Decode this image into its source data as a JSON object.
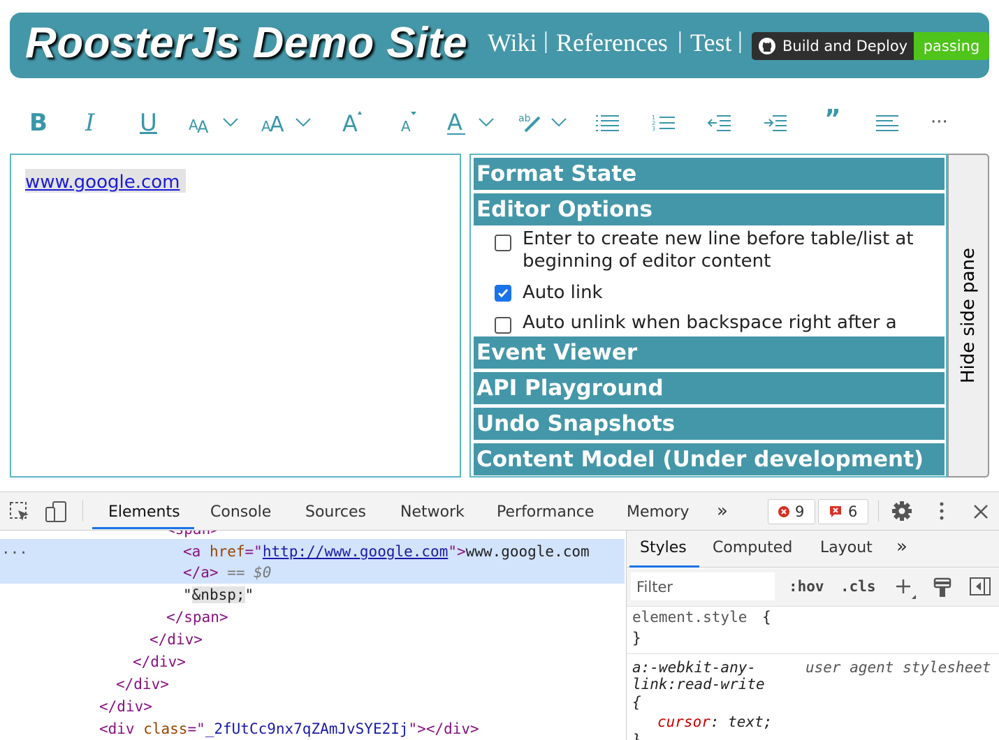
{
  "header": {
    "title": "RoosterJs Demo Site",
    "links": [
      "Wiki",
      "References",
      "Test"
    ],
    "separator": "|",
    "badge_label": "Build and Deploy",
    "badge_status": "passing"
  },
  "toolbar": {
    "bold": "B",
    "italic": "I",
    "underline": "U",
    "more": "···",
    "quote": "”"
  },
  "editor": {
    "link_text": "www.google.com"
  },
  "sidepane": {
    "sections": [
      "Format State",
      "Editor Options",
      "Event Viewer",
      "API Playground",
      "Undo Snapshots",
      "Content Model (Under development)"
    ],
    "options": [
      {
        "label": "Enter to create new line before table/list at beginning of editor content",
        "checked": false
      },
      {
        "label": "Auto link",
        "checked": true
      },
      {
        "label": "Auto unlink when backspace right after a",
        "checked": false
      }
    ],
    "hide_button": "Hide side pane"
  },
  "devtools": {
    "tabs": [
      "Elements",
      "Console",
      "Sources",
      "Network",
      "Performance",
      "Memory"
    ],
    "more_tabs": "»",
    "error_count": "9",
    "warning_count": "6",
    "dom": {
      "partial_span": "<span>",
      "a_open": "<a",
      "href_attr": "href",
      "href_value": "http://www.google.com",
      "a_text": "www.google.com",
      "a_close": "</a>",
      "eq": "== $0",
      "nbsp": "&nbsp;",
      "span_close": "</span>",
      "div_close": "</div>",
      "div_class_attr": "class",
      "div_class_value": "_2fUtCc9nx7qZAmJvSYE2Ij"
    },
    "styles_tabs": [
      "Styles",
      "Computed",
      "Layout"
    ],
    "filter_placeholder": "Filter",
    "hov": ":hov",
    "cls": ".cls",
    "element_style": "element.style",
    "rule_selector_1": "a:-webkit-any-",
    "rule_selector_2": "link:read-write",
    "rule_origin": "user agent stylesheet",
    "rule_prop": "cursor",
    "rule_val": "text;"
  }
}
